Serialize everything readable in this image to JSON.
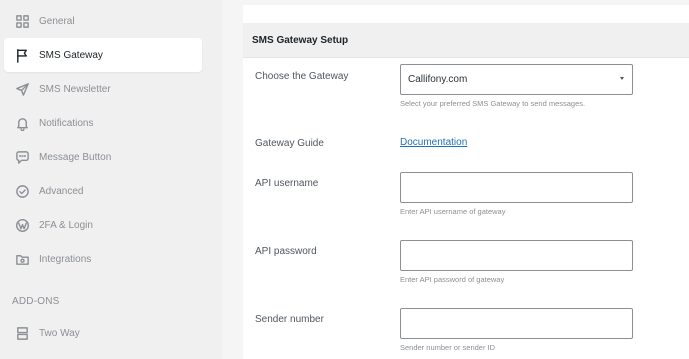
{
  "sidebar": {
    "items": [
      {
        "label": "General",
        "icon": "grid-icon"
      },
      {
        "label": "SMS Gateway",
        "icon": "flag-icon",
        "active": true
      },
      {
        "label": "SMS Newsletter",
        "icon": "send-icon"
      },
      {
        "label": "Notifications",
        "icon": "bell-icon"
      },
      {
        "label": "Message Button",
        "icon": "chat-bubble-icon"
      },
      {
        "label": "Advanced",
        "icon": "check-circle-icon"
      },
      {
        "label": "2FA & Login",
        "icon": "wordpress-icon"
      },
      {
        "label": "Integrations",
        "icon": "folder-gear-icon"
      }
    ],
    "addons_label": "ADD-ONS",
    "addons": [
      {
        "label": "Two Way",
        "icon": "server-icon"
      }
    ]
  },
  "panel": {
    "title": "SMS Gateway Setup",
    "gateway": {
      "label": "Choose the Gateway",
      "value": "Callifony.com",
      "help": "Select your preferred SMS Gateway to send messages."
    },
    "guide": {
      "label": "Gateway Guide",
      "link": "Documentation"
    },
    "username": {
      "label": "API username",
      "value": "",
      "help": "Enter API username of gateway"
    },
    "password": {
      "label": "API password",
      "value": "",
      "help": "Enter API password of gateway"
    },
    "sender": {
      "label": "Sender number",
      "value": "",
      "help": "Sender number or sender ID"
    }
  },
  "colors": {
    "sidebar_bg": "#f0f0f1",
    "link": "#2271b1",
    "text_muted": "#8c8f94"
  }
}
